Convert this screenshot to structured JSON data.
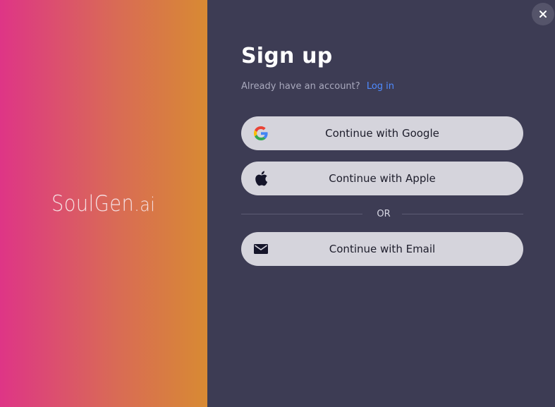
{
  "brand": {
    "logo_text": "SoulGen",
    "logo_suffix": ".ai"
  },
  "form": {
    "title": "Sign up",
    "account_prompt": "Already have an account?",
    "login_link": "Log in",
    "divider_text": "OR"
  },
  "buttons": {
    "google_label": "Continue with Google",
    "apple_label": "Continue with Apple",
    "email_label": "Continue with Email"
  },
  "icons": {
    "close": "close-icon",
    "google": "google-icon",
    "apple": "apple-icon",
    "email": "envelope-icon"
  },
  "colors": {
    "gradient_start": "#de3586",
    "gradient_end": "#d88a33",
    "panel_bg": "#3d3c54",
    "button_bg": "#d5d4dc",
    "link": "#4f8bff"
  }
}
